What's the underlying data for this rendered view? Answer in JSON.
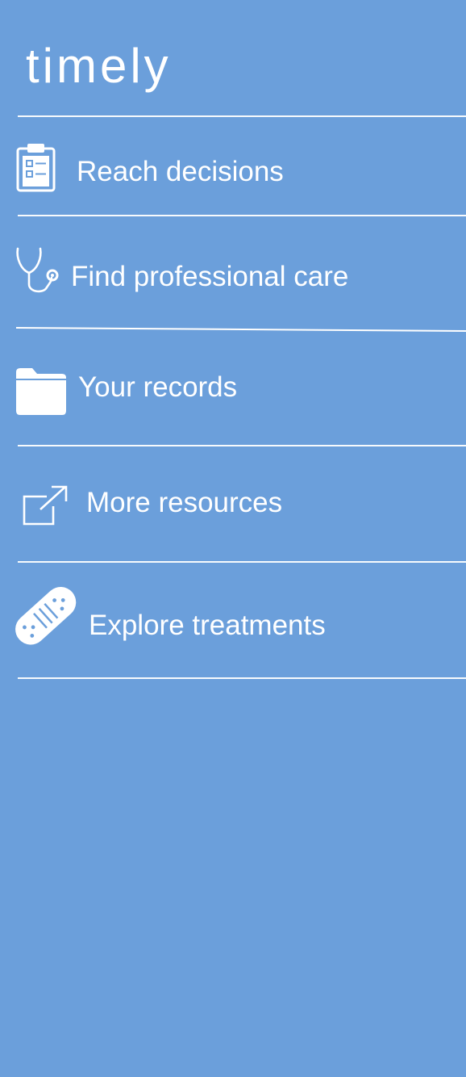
{
  "app": {
    "title": "timely",
    "background_color": "#6b9fdb",
    "foreground_color": "#ffffff"
  },
  "menu": {
    "items": [
      {
        "label": "Reach decisions",
        "icon": "clipboard-checklist-icon"
      },
      {
        "label": "Find professional care",
        "icon": "stethoscope-icon"
      },
      {
        "label": "Your records",
        "icon": "folder-icon"
      },
      {
        "label": "More resources",
        "icon": "external-link-icon"
      },
      {
        "label": "Explore treatments",
        "icon": "bandage-icon"
      }
    ]
  }
}
